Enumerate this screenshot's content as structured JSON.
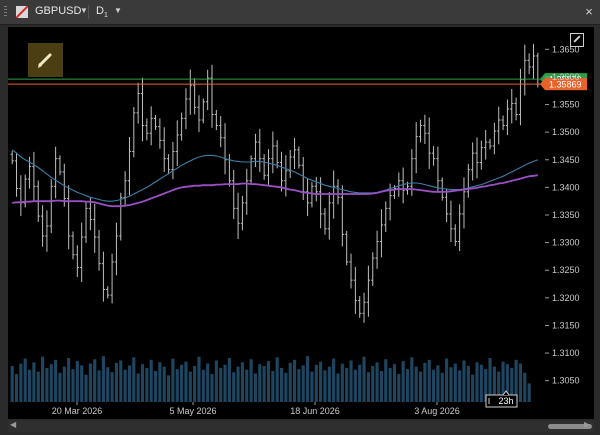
{
  "header": {
    "symbol": "GBPUSD",
    "timeframe": "D",
    "timeframe_sub": "1",
    "close_glyph": "×",
    "icons": [
      "chart-symbol-icon",
      "dropdown-caret-icon",
      "close-icon",
      "chart-settings-icon",
      "pencil-icon"
    ]
  },
  "chart_data": {
    "type": "ohlc",
    "instrument": "GBPUSD",
    "timeframe": "D1",
    "ylim": [
      1.3015,
      1.3685
    ],
    "y_ticks": [
      "1.3650",
      "1.3600",
      "1.3550",
      "1.3500",
      "1.3450",
      "1.3400",
      "1.3350",
      "1.3300",
      "1.3250",
      "1.3200",
      "1.3150",
      "1.3100",
      "1.3050"
    ],
    "x_ticks": [
      "20 Mar 2026",
      "5 May 2026",
      "18 Jun 2026",
      "3 Aug 2026"
    ],
    "grid": false,
    "price_lines": [
      {
        "label": "1.35870",
        "value": 1.3587,
        "color": "#2e9e46"
      },
      {
        "label": "1.35869",
        "value": 1.35869,
        "color": "#e8622c"
      }
    ],
    "countdown": "23h",
    "closes": [
      1.3448,
      1.3398,
      1.3372,
      1.3415,
      1.3438,
      1.3402,
      1.3348,
      1.3312,
      1.333,
      1.3402,
      1.3452,
      1.3428,
      1.338,
      1.3312,
      1.3278,
      1.3255,
      1.331,
      1.3362,
      1.3342,
      1.331,
      1.3262,
      1.3215,
      1.3205,
      1.3265,
      1.3312,
      1.3382,
      1.3412,
      1.3465,
      1.3535,
      1.357,
      1.3512,
      1.3498,
      1.3525,
      1.351,
      1.3485,
      1.3452,
      1.3432,
      1.3465,
      1.3495,
      1.3525,
      1.356,
      1.3585,
      1.3545,
      1.3522,
      1.3555,
      1.3598,
      1.3532,
      1.3512,
      1.349,
      1.345,
      1.3412,
      1.3362,
      1.3335,
      1.3372,
      1.3412,
      1.3452,
      1.3482,
      1.3452,
      1.3422,
      1.3452,
      1.3475,
      1.3445,
      1.3412,
      1.343,
      1.3455,
      1.3468,
      1.344,
      1.3392,
      1.3372,
      1.3402,
      1.3392,
      1.3352,
      1.3325,
      1.3372,
      1.3402,
      1.3382,
      1.3315,
      1.3265,
      1.3232,
      1.3195,
      1.3172,
      1.3192,
      1.3232,
      1.3272,
      1.3302,
      1.3332,
      1.3362,
      1.3385,
      1.3398,
      1.3412,
      1.3395,
      1.3402,
      1.3452,
      1.3492,
      1.3512,
      1.3498,
      1.3462,
      1.3452,
      1.3412,
      1.3382,
      1.3352,
      1.3325,
      1.3302,
      1.3352,
      1.3392,
      1.3432,
      1.3462,
      1.3445,
      1.3472,
      1.3482,
      1.3475,
      1.3502,
      1.3522,
      1.3512,
      1.3542,
      1.3552,
      1.3532,
      1.3595,
      1.363,
      1.3618,
      1.3638,
      1.3587
    ],
    "volumes": [
      0.58,
      0.45,
      0.62,
      0.7,
      0.52,
      0.64,
      0.49,
      0.73,
      0.55,
      0.61,
      0.68,
      0.47,
      0.57,
      0.71,
      0.53,
      0.66,
      0.59,
      0.44,
      0.62,
      0.69,
      0.51,
      0.74,
      0.56,
      0.48,
      0.63,
      0.67,
      0.52,
      0.59,
      0.72,
      0.46,
      0.61,
      0.55,
      0.68,
      0.5,
      0.64,
      0.57,
      0.43,
      0.7,
      0.53,
      0.6,
      0.65,
      0.49,
      0.58,
      0.73,
      0.52,
      0.62,
      0.45,
      0.67,
      0.55,
      0.6,
      0.71,
      0.48,
      0.57,
      0.64,
      0.52,
      0.69,
      0.46,
      0.61,
      0.58,
      0.66,
      0.5,
      0.72,
      0.55,
      0.47,
      0.63,
      0.68,
      0.53,
      0.59,
      0.74,
      0.49,
      0.6,
      0.65,
      0.51,
      0.57,
      0.7,
      0.46,
      0.62,
      0.55,
      0.67,
      0.52,
      0.6,
      0.73,
      0.48,
      0.58,
      0.64,
      0.5,
      0.69,
      0.55,
      0.61,
      0.45,
      0.66,
      0.53,
      0.72,
      0.57,
      0.49,
      0.63,
      0.68,
      0.52,
      0.59,
      0.47,
      0.7,
      0.56,
      0.62,
      0.51,
      0.67,
      0.58,
      0.44,
      0.64,
      0.6,
      0.53,
      0.71,
      0.57,
      0.49,
      0.65,
      0.61,
      0.55,
      0.68,
      0.62,
      0.47,
      0.3
    ],
    "ma_fast": [
      1.3468,
      1.3462,
      1.3455,
      1.345,
      1.3446,
      1.3441,
      1.3436,
      1.343,
      1.3424,
      1.3418,
      1.3413,
      1.3408,
      1.3403,
      1.3399,
      1.3395,
      1.3391,
      1.3388,
      1.3385,
      1.3382,
      1.338,
      1.3378,
      1.3376,
      1.3375,
      1.3375,
      1.3376,
      1.3378,
      1.3381,
      1.3384,
      1.3388,
      1.3392,
      1.3396,
      1.34,
      1.3405,
      1.341,
      1.3415,
      1.342,
      1.3425,
      1.343,
      1.3435,
      1.344,
      1.3444,
      1.3448,
      1.3452,
      1.3455,
      1.3457,
      1.3458,
      1.3458,
      1.3457,
      1.3455,
      1.3452,
      1.345,
      1.3448,
      1.3447,
      1.3446,
      1.3446,
      1.3446,
      1.3447,
      1.3447,
      1.3446,
      1.3444,
      1.3442,
      1.344,
      1.3437,
      1.3434,
      1.3431,
      1.3428,
      1.3424,
      1.342,
      1.3416,
      1.3413,
      1.341,
      1.3407,
      1.3404,
      1.3402,
      1.34,
      1.3398,
      1.3396,
      1.3394,
      1.3392,
      1.3391,
      1.339,
      1.339,
      1.339,
      1.339,
      1.3391,
      1.3393,
      1.3395,
      1.3398,
      1.34,
      1.3403,
      1.3405,
      1.3407,
      1.3408,
      1.3408,
      1.3407,
      1.3405,
      1.3403,
      1.3401,
      1.3399,
      1.3398,
      1.3397,
      1.3396,
      1.3396,
      1.3396,
      1.3397,
      1.3399,
      1.3401,
      1.3403,
      1.3405,
      1.3408,
      1.3411,
      1.3414,
      1.3417,
      1.342,
      1.3424,
      1.3428,
      1.3432,
      1.3436,
      1.344,
      1.3444,
      1.3447,
      1.345
    ],
    "ma_slow": [
      1.3372,
      1.3373,
      1.3373,
      1.3374,
      1.3374,
      1.3375,
      1.3375,
      1.3375,
      1.3375,
      1.3375,
      1.3376,
      1.3376,
      1.3375,
      1.3375,
      1.3375,
      1.3375,
      1.3375,
      1.3374,
      1.3374,
      1.3373,
      1.3371,
      1.3369,
      1.3367,
      1.3366,
      1.3366,
      1.3366,
      1.3367,
      1.3368,
      1.337,
      1.3372,
      1.3374,
      1.3377,
      1.338,
      1.3383,
      1.3386,
      1.3389,
      1.3392,
      1.3395,
      1.3398,
      1.34,
      1.3401,
      1.3402,
      1.3403,
      1.3403,
      1.3404,
      1.3404,
      1.3404,
      1.3405,
      1.3405,
      1.3406,
      1.3406,
      1.3406,
      1.3406,
      1.3407,
      1.3407,
      1.3406,
      1.3406,
      1.3405,
      1.3404,
      1.3403,
      1.3402,
      1.3401,
      1.34,
      1.3398,
      1.3396,
      1.3395,
      1.3393,
      1.3391,
      1.339,
      1.3389,
      1.3388,
      1.3388,
      1.3388,
      1.3388,
      1.3388,
      1.3388,
      1.3388,
      1.3388,
      1.3388,
      1.3388,
      1.3388,
      1.3388,
      1.3388,
      1.3389,
      1.339,
      1.3392,
      1.3394,
      1.3395,
      1.3396,
      1.3397,
      1.3397,
      1.3397,
      1.3397,
      1.3396,
      1.3395,
      1.3394,
      1.3393,
      1.3392,
      1.3392,
      1.3392,
      1.3392,
      1.3393,
      1.3394,
      1.3395,
      1.3396,
      1.3397,
      1.3398,
      1.3399,
      1.3401,
      1.3402,
      1.3404,
      1.3405,
      1.3407,
      1.3408,
      1.341,
      1.3412,
      1.3414,
      1.3416,
      1.3418,
      1.342,
      1.3421,
      1.3422
    ],
    "colors": {
      "bars": "#bfbfbf",
      "ma_fast": "#3a7fa6",
      "ma_slow": "#9b4fc4",
      "volume": "#1f4661",
      "background": "#000000"
    }
  }
}
